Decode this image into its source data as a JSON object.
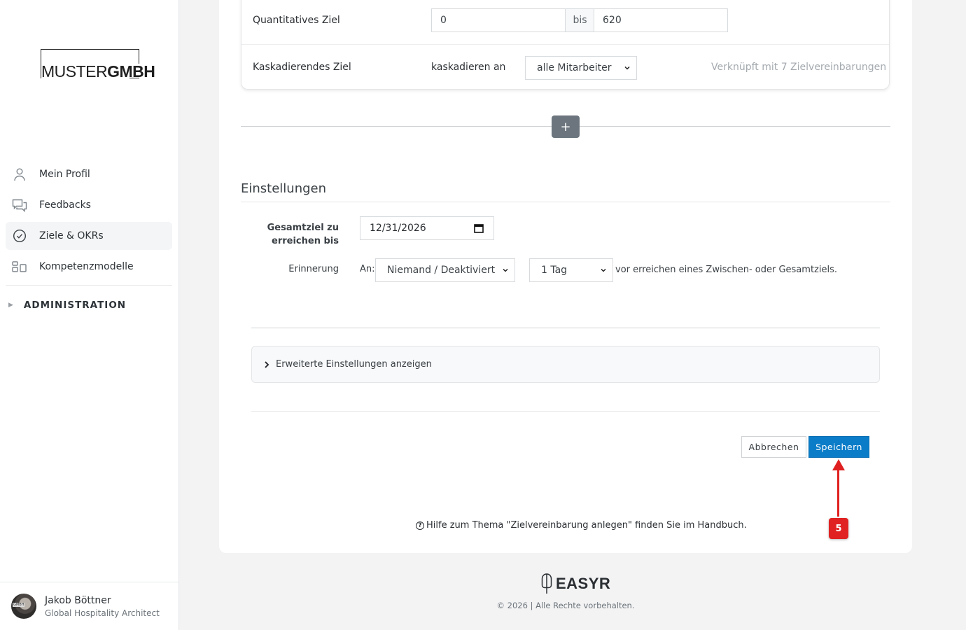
{
  "brand": {
    "logo_prefix": "MUSTER",
    "logo_bold": "GMBH"
  },
  "sidebar": {
    "items": [
      {
        "label": "Mein Profil",
        "icon": "user-icon",
        "active": false
      },
      {
        "label": "Feedbacks",
        "icon": "chat-icon",
        "active": false
      },
      {
        "label": "Ziele & OKRs",
        "icon": "check-circle-icon",
        "active": true
      },
      {
        "label": "Kompetenzmodelle",
        "icon": "grid-icon",
        "active": false
      }
    ],
    "admin_label": "ADMINISTRATION"
  },
  "user": {
    "name": "Jakob Böttner",
    "role": "Global Hospitality Architect",
    "avatar_tag": "GMBH"
  },
  "goal": {
    "quant_label": "Quantitatives Ziel",
    "quant_from": "0",
    "quant_bis": "bis",
    "quant_to": "620",
    "cascade_label": "Kaskadierendes Ziel",
    "cascade_text": "kaskadieren an",
    "cascade_select": "alle Mitarbeiter",
    "linked_text": "Verknüpft mit 7 Zielvereinbarungen"
  },
  "add_button": "+",
  "settings": {
    "title": "Einstellungen",
    "total_goal_label_1": "Gesamtziel zu",
    "total_goal_label_2": "erreichen bis",
    "total_goal_date": "12/31/2026",
    "reminder_label": "Erinnerung",
    "an_label": "An:",
    "reminder_to": "Niemand / Deaktiviert",
    "reminder_offset": "1 Tag",
    "reminder_suffix": "vor erreichen eines Zwischen- oder Gesamtziels."
  },
  "advanced": {
    "label": "Erweiterte Einstellungen anzeigen"
  },
  "actions": {
    "cancel": "Abbrechen",
    "save": "Speichern"
  },
  "help": {
    "text": "Hilfe zum Thema \"Zielvereinbarung anlegen\" finden Sie im Handbuch.",
    "icon": "?"
  },
  "annotation": {
    "badge": "5",
    "color": "#e02020"
  },
  "footer": {
    "logo": "EASYR",
    "copyright": "© 2026 | Alle Rechte vorbehalten."
  },
  "colors": {
    "primary": "#0b7cc8",
    "sidebar_bg": "#ffffff",
    "page_bg": "#f3f3f4"
  }
}
